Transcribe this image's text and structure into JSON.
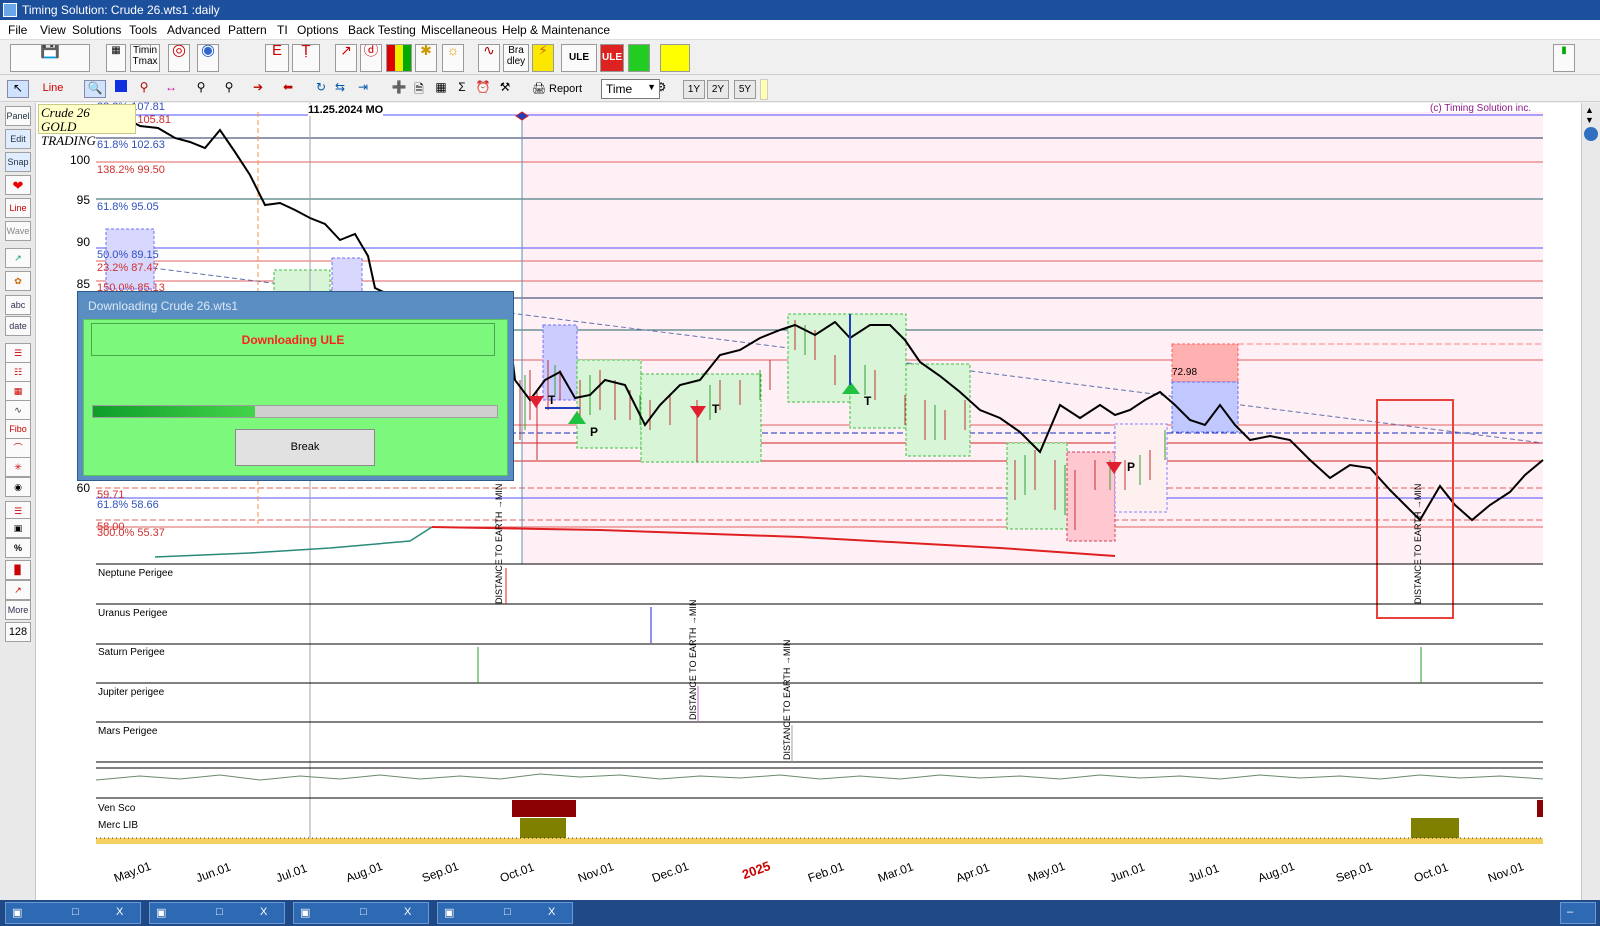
{
  "window": {
    "title": "Timing Solution:  Crude 26.wts1 :daily"
  },
  "menu": [
    "File",
    "View",
    "Solutions",
    "Tools",
    "Advanced",
    "Pattern",
    "TI",
    "Options",
    "Back Testing",
    "Miscellaneous",
    "Help & Maintenance"
  ],
  "toolbar1": {
    "timing_btn": "Timin Tmax",
    "bradley_btn": "Bra dley",
    "ule_btn": "ULE",
    "ule_red_btn": "ULE"
  },
  "toolbar2": {
    "line_btn": "Line",
    "report_btn": "Report",
    "time_select": "Time",
    "yr1": "1Y",
    "yr2": "2Y",
    "yr5": "5Y"
  },
  "leftbar": [
    "Panel",
    "Edit",
    "Snap",
    "Line",
    "Wave",
    "abc",
    "date",
    "Fibo",
    "%",
    "More",
    "128"
  ],
  "chart": {
    "corner_line1": "Crude 26",
    "corner_line2": "GOLD TRADING",
    "cursor_date": "11.25.2024 MO",
    "copyright": "(c) Timing Solution inc.",
    "price_label": "72.98",
    "y_ticks": [
      "100",
      "95",
      "90",
      "85",
      "60"
    ],
    "fib_labels": [
      {
        "text": "38.2% 107.81",
        "color": "#3050c0"
      },
      {
        "text": "138.2% 105.81",
        "color": "#d03030"
      },
      {
        "text": "61.8% 102.63",
        "color": "#3050c0"
      },
      {
        "text": "138.2% 99.50",
        "color": "#d03030"
      },
      {
        "text": "61.8% 95.05",
        "color": "#3050c0"
      },
      {
        "text": "50.0% 89.15",
        "color": "#3050c0"
      },
      {
        "text": "23.2% 87.47",
        "color": "#d03030"
      },
      {
        "text": "150.0% 85.13",
        "color": "#d03030"
      },
      {
        "text": "59.71",
        "color": "#d03030"
      },
      {
        "text": "61.8% 58.66",
        "color": "#3050c0"
      },
      {
        "text": "58.00",
        "color": "#d03030"
      },
      {
        "text": "300.0% 55.37",
        "color": "#d03030"
      }
    ],
    "planet_rows": [
      "Neptune Perigee",
      "Uranus Perigee",
      "Saturn Perigee",
      "Jupiter perigee",
      "Mars Perigee"
    ],
    "bottom_rows": [
      "Ven Sco",
      "Merc LIB"
    ],
    "vertical_notes": [
      "DISTANCE TO EARTH →MIN",
      "DISTANCE TO EARTH →MIN",
      "DISTANCE TO EARTH →MIN",
      "DISTANCE TO EARTH →MIN"
    ],
    "markers": [
      "T",
      "P",
      "T",
      "T",
      "P"
    ],
    "x_labels": [
      "May.01",
      "Jun.01",
      "Jul.01",
      "Aug.01",
      "Sep.01",
      "Oct.01",
      "Nov.01",
      "Dec.01",
      "Feb.01",
      "Mar.01",
      "Apr.01",
      "May.01",
      "Jun.01",
      "Jul.01",
      "Aug.01",
      "Sep.01",
      "Oct.01",
      "Nov.01"
    ],
    "year_label": "2025"
  },
  "dialog": {
    "title": "Downloading Crude 26.wts1",
    "message": "Downloading ULE",
    "progress": 0.4,
    "break_btn": "Break"
  },
  "taskbar": {
    "close": "X",
    "restore": "□",
    "minimize": "–"
  },
  "colors": {
    "accent": "#1c4f9c",
    "dialog_bg": "#7cf87c",
    "highlight_box": "#e8403a"
  }
}
